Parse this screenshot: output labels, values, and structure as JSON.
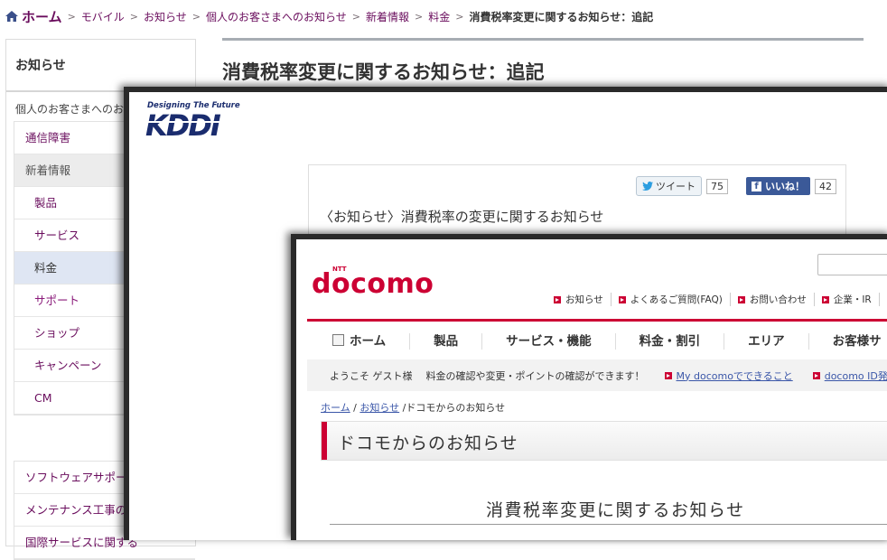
{
  "layer1": {
    "breadcrumb": {
      "home": "ホーム",
      "items": [
        "モバイル",
        "お知らせ",
        "個人のお客さまへのお知らせ",
        "新着情報",
        "料金"
      ],
      "current": "消費税率変更に関するお知らせ：追記",
      "separator": ">"
    },
    "sidebar": {
      "heading": "お知らせ",
      "subheading": "個人のお客さまへのお知",
      "items": [
        {
          "label": "通信障害"
        },
        {
          "label": "新着情報"
        },
        {
          "label": "製品"
        },
        {
          "label": "サービス"
        },
        {
          "label": "料金"
        },
        {
          "label": "サポート"
        },
        {
          "label": "ショップ"
        },
        {
          "label": "キャンペーン"
        },
        {
          "label": "CM"
        }
      ],
      "items2": [
        {
          "label": "ソフトウェアサポート"
        },
        {
          "label": "メンテナンス工事のお"
        },
        {
          "label": "国際サービスに関する"
        }
      ]
    },
    "title": "消費税率変更に関するお知らせ：追記",
    "colors": {
      "brand": "#6a0d5d",
      "rule": "#a7adb3"
    }
  },
  "kddi": {
    "tagline": "Designing The Future",
    "logo_text": "KDDI",
    "tweet_label": "ツイート",
    "tweet_count": "75",
    "like_label": "いいね！",
    "like_count": "42",
    "title": "〈お知らせ〉消費税率の変更に関するお知らせ",
    "colors": {
      "logo": "#1a2c6e",
      "facebook": "#3b5998"
    }
  },
  "docomo": {
    "ntt_label": "NTT",
    "logo": "docomo",
    "util_links": [
      "お知らせ",
      "よくあるご質問(FAQ)",
      "お問い合わせ",
      "企業・IR"
    ],
    "nav": [
      "ホーム",
      "製品",
      "サービス・機能",
      "料金・割引",
      "エリア",
      "お客様サ"
    ],
    "welcome": "ようこそ ゲスト様",
    "welcome_msg": "料金の確認や変更・ポイントの確認ができます！",
    "welcome_link1": "My docomoでできること",
    "welcome_link2": "docomo ID発行",
    "breadcrumb": {
      "home": "ホーム",
      "sep": "/",
      "link": "お知らせ",
      "current": "ドコモからのお知らせ"
    },
    "section_title": "ドコモからのお知らせ",
    "title": "消費税率変更に関するお知らせ",
    "colors": {
      "brand": "#cc0033",
      "link": "#3a56a8"
    }
  }
}
